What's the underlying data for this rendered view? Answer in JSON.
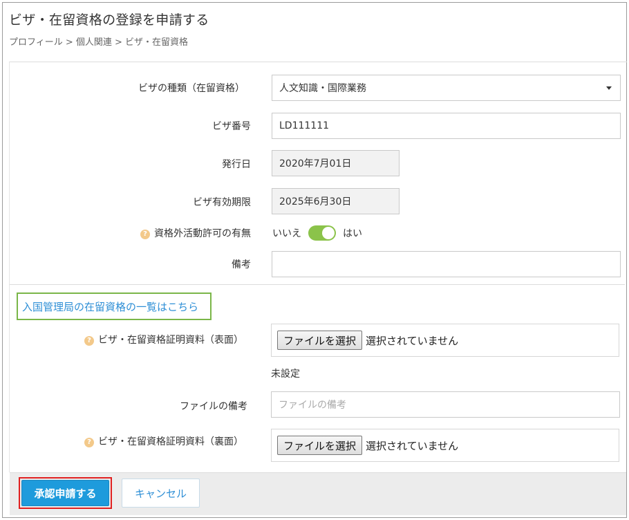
{
  "header": {
    "title": "ビザ・在留資格の登録を申請する",
    "breadcrumb": "プロフィール > 個人関連 > ビザ・在留資格"
  },
  "form": {
    "visa_type": {
      "label": "ビザの種類（在留資格）",
      "value": "人文知識・国際業務"
    },
    "visa_number": {
      "label": "ビザ番号",
      "value": "LD111111"
    },
    "issue_date": {
      "label": "発行日",
      "value": "2020年7月01日"
    },
    "expiry_date": {
      "label": "ビザ有効期限",
      "value": "2025年6月30日"
    },
    "work_permit": {
      "label": "資格外活動許可の有無",
      "off_label": "いいえ",
      "on_label": "はい",
      "value": true
    },
    "remarks": {
      "label": "備考",
      "value": ""
    },
    "status_list_link": "入国管理局の在留資格の一覧はこちら",
    "front_doc": {
      "label": "ビザ・在留資格証明資料（表面）",
      "button": "ファイルを選択",
      "status": "選択されていません",
      "current": "未設定"
    },
    "file_remarks": {
      "label": "ファイルの備考",
      "placeholder": "ファイルの備考"
    },
    "back_doc": {
      "label": "ビザ・在留資格証明資料（裏面）",
      "button": "ファイルを選択",
      "status": "選択されていません"
    }
  },
  "footer": {
    "submit_label": "承認申請する",
    "cancel_label": "キャンセル"
  },
  "colors": {
    "accent": "#1e9bdc",
    "toggle_on": "#8bc34a",
    "link": "#2e8fd6",
    "help_icon": "#f3c98a",
    "highlight_green": "#7ab648",
    "highlight_red": "#e02020"
  },
  "icons": {
    "help": "question-circle-icon",
    "dropdown": "caret-down-icon"
  }
}
